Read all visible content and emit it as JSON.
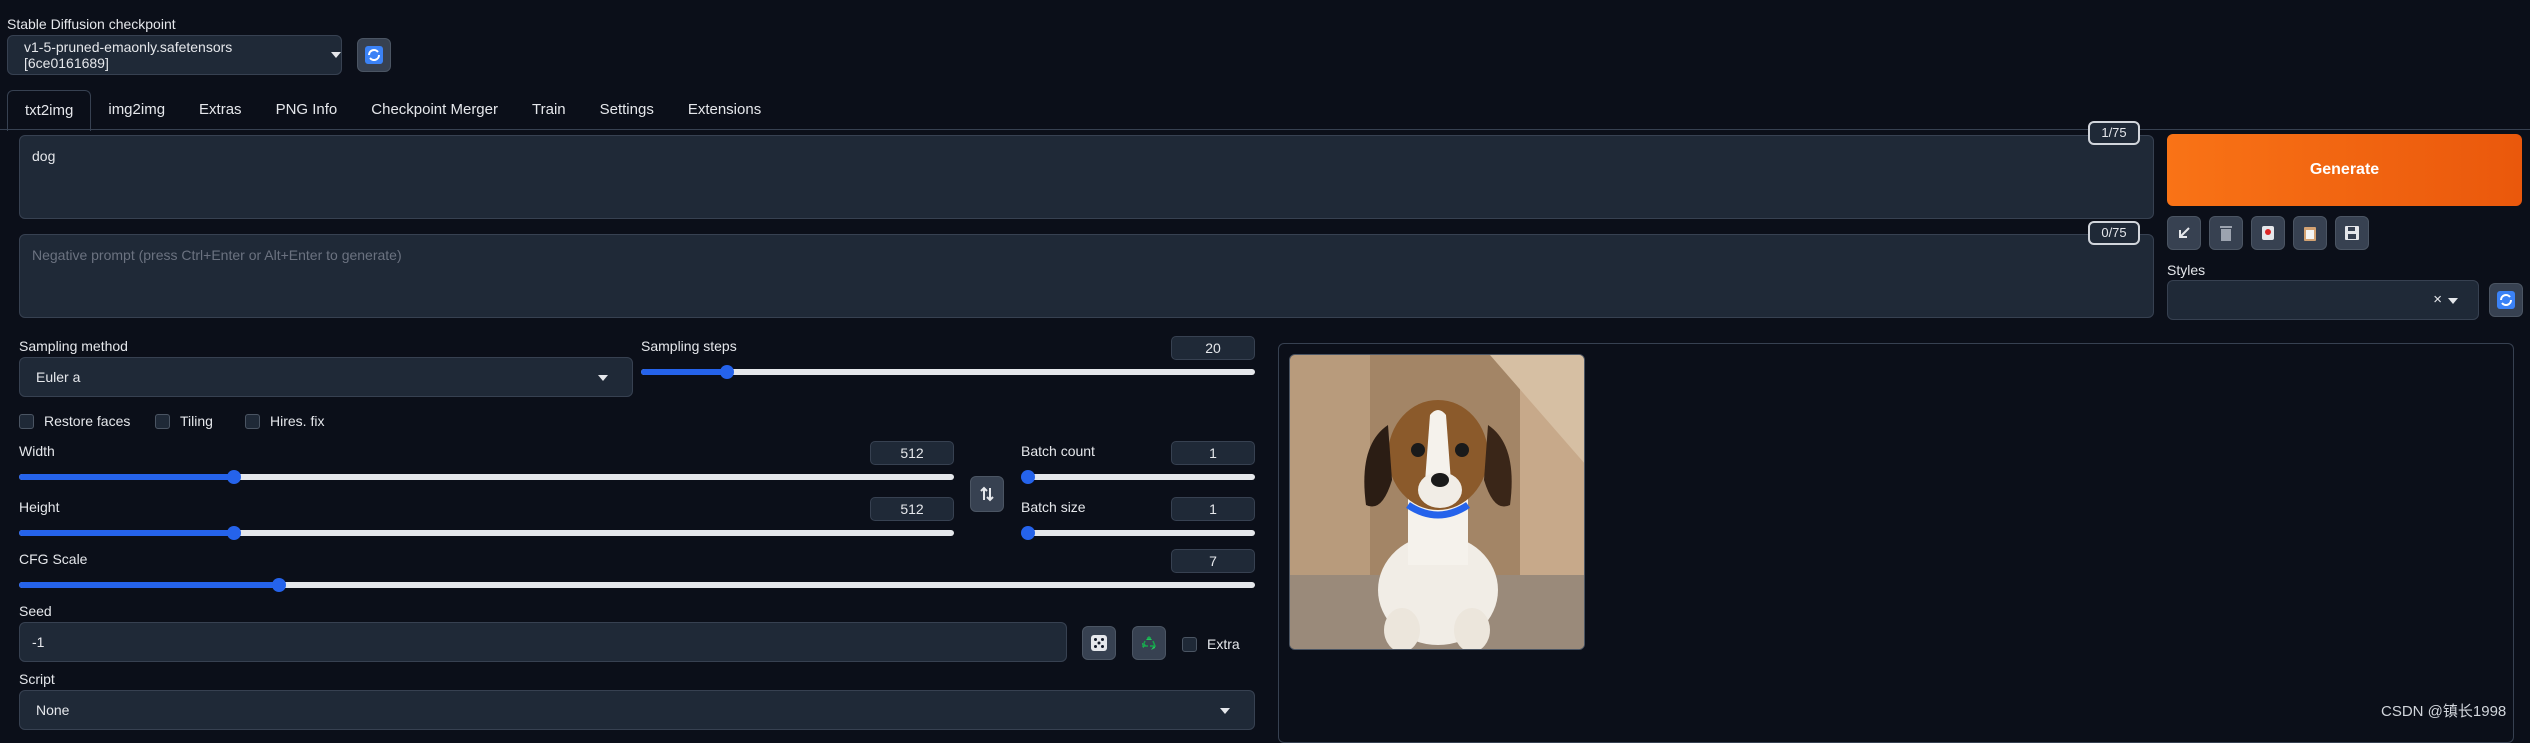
{
  "checkpoint": {
    "label": "Stable Diffusion checkpoint",
    "value": "v1-5-pruned-emaonly.safetensors [6ce0161689]"
  },
  "tabs": [
    {
      "label": "txt2img"
    },
    {
      "label": "img2img"
    },
    {
      "label": "Extras"
    },
    {
      "label": "PNG Info"
    },
    {
      "label": "Checkpoint Merger"
    },
    {
      "label": "Train"
    },
    {
      "label": "Settings"
    },
    {
      "label": "Extensions"
    }
  ],
  "prompt": {
    "value": "dog",
    "counter": "1/75"
  },
  "negative_prompt": {
    "value": "",
    "placeholder": "Negative prompt (press Ctrl+Enter or Alt+Enter to generate)",
    "counter": "0/75"
  },
  "generate": {
    "label": "Generate",
    "color": "#ea580c"
  },
  "styles": {
    "label": "Styles",
    "value": "",
    "clear": "×"
  },
  "sampling": {
    "method_label": "Sampling method",
    "method_value": "Euler a",
    "steps_label": "Sampling steps",
    "steps_value": "20",
    "steps_fraction": 0.14
  },
  "checkboxes": {
    "restore_faces": "Restore faces",
    "tiling": "Tiling",
    "hires_fix": "Hires. fix"
  },
  "width": {
    "label": "Width",
    "value": "512",
    "fraction": 0.23
  },
  "height": {
    "label": "Height",
    "value": "512",
    "fraction": 0.23
  },
  "batch_count": {
    "label": "Batch count",
    "value": "1",
    "fraction": 0.0
  },
  "batch_size": {
    "label": "Batch size",
    "value": "1",
    "fraction": 0.0
  },
  "cfg": {
    "label": "CFG Scale",
    "value": "7",
    "fraction": 0.21
  },
  "seed": {
    "label": "Seed",
    "value": "-1",
    "extra_label": "Extra"
  },
  "script": {
    "label": "Script",
    "value": "None"
  },
  "watermark": "CSDN @镇长1998",
  "accent_color": "#2563eb"
}
